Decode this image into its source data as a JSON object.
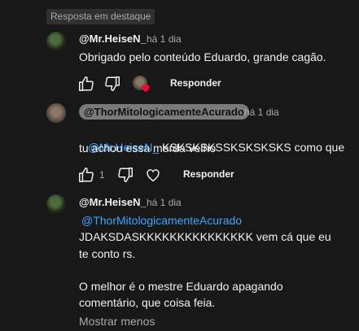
{
  "highlight_badge": "Resposta em destaque",
  "comments": [
    {
      "author": "@Mr.HeiseN_",
      "time": "há 1 dia",
      "text": "Obrigado pelo conteúdo Eduardo, grande cagão.",
      "reply_label": "Responder"
    },
    {
      "author": "@ThorMitologicamenteAcurado",
      "time": "há 1 dia",
      "mention": "@Mr.HeiseN_",
      "text_after_mention": " KSKSKSKSSKSKSKSKS como que",
      "text_line2": "tu achou essa merda velho",
      "like_count": "1",
      "reply_label": "Responder"
    },
    {
      "author": "@Mr.HeiseN_",
      "time": "há 1 dia",
      "mention": "@ThorMitologicamenteAcurado",
      "text_line1": "JDAKSDASKKKKKKKKKKKKKKK vem cá que eu",
      "text_line2": "te conto rs.",
      "text_line3": "O melhor é o mestre Eduardo apagando",
      "text_line4": "comentário, que coisa feia."
    }
  ],
  "show_less": "Mostrar menos",
  "colors": {
    "background": "#181818",
    "link": "#3ea6ff",
    "heart": "#ff0033"
  }
}
